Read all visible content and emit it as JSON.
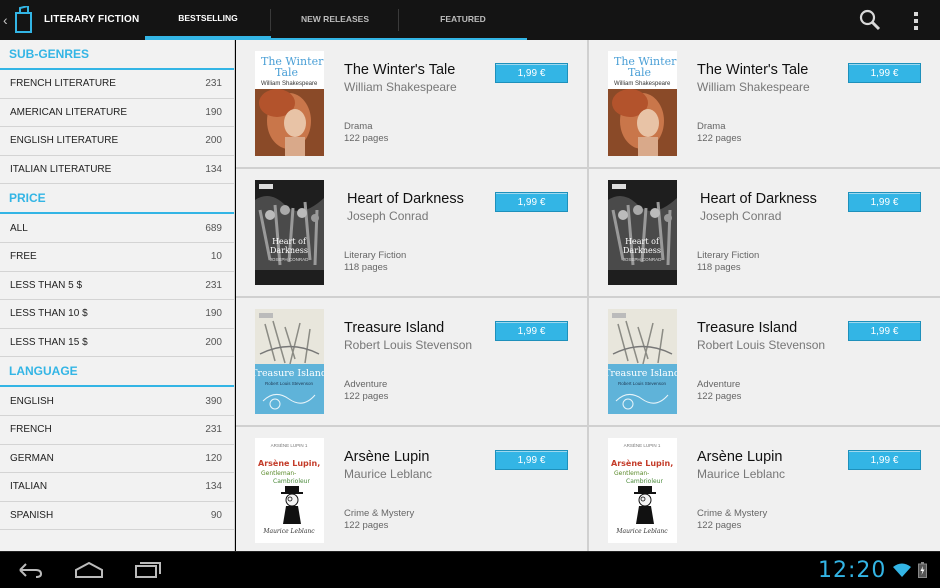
{
  "header": {
    "title": "LITERARY FICTION",
    "tabs": [
      {
        "label": "BESTSELLING",
        "active": true
      },
      {
        "label": "NEW RELEASES",
        "active": false
      },
      {
        "label": "FEATURED",
        "active": false
      }
    ],
    "accent": "#33b5e5"
  },
  "sidebar": {
    "sections": [
      {
        "title": "SUB-GENRES",
        "items": [
          {
            "label": "FRENCH LITERATURE",
            "count": "231"
          },
          {
            "label": "AMERICAN LITERATURE",
            "count": "190"
          },
          {
            "label": "ENGLISH LITERATURE",
            "count": "200"
          },
          {
            "label": "ITALIAN LITERATURE",
            "count": "134"
          }
        ]
      },
      {
        "title": "PRICE",
        "items": [
          {
            "label": "ALL",
            "count": "689"
          },
          {
            "label": "FREE",
            "count": "10"
          },
          {
            "label": "LESS THAN 5 $",
            "count": "231"
          },
          {
            "label": "LESS THAN 10 $",
            "count": "190"
          },
          {
            "label": "LESS THAN 15 $",
            "count": "200"
          }
        ]
      },
      {
        "title": "LANGUAGE",
        "items": [
          {
            "label": "ENGLISH",
            "count": "390"
          },
          {
            "label": "FRENCH",
            "count": "231"
          },
          {
            "label": "GERMAN",
            "count": "120"
          },
          {
            "label": "ITALIAN",
            "count": "134"
          },
          {
            "label": "SPANISH",
            "count": "90"
          }
        ]
      }
    ]
  },
  "books": [
    {
      "title": "The Winter's Tale",
      "author": "William Shakespeare",
      "genre": "Drama",
      "pages": "122 pages",
      "price": "1,99 €",
      "cover": "winter"
    },
    {
      "title": "The Winter's Tale",
      "author": "William Shakespeare",
      "genre": "Drama",
      "pages": "122 pages",
      "price": "1,99 €",
      "cover": "winter"
    },
    {
      "title": "Heart of Darkness",
      "author": "Joseph Conrad",
      "genre": "Literary Fiction",
      "pages": "118 pages",
      "price": "1,99 €",
      "cover": "heart"
    },
    {
      "title": "Heart of Darkness",
      "author": "Joseph Conrad",
      "genre": "Literary Fiction",
      "pages": "118 pages",
      "price": "1,99 €",
      "cover": "heart"
    },
    {
      "title": "Treasure Island",
      "author": "Robert Louis Stevenson",
      "genre": "Adventure",
      "pages": "122 pages",
      "price": "1,99 €",
      "cover": "treasure"
    },
    {
      "title": "Treasure Island",
      "author": "Robert Louis Stevenson",
      "genre": "Adventure",
      "pages": "122 pages",
      "price": "1,99 €",
      "cover": "treasure"
    },
    {
      "title": "Arsène Lupin",
      "author": "Maurice Leblanc",
      "genre": "Crime & Mystery",
      "pages": "122 pages",
      "price": "1,99 €",
      "cover": "lupin"
    },
    {
      "title": "Arsène Lupin",
      "author": "Maurice Leblanc",
      "genre": "Crime & Mystery",
      "pages": "122 pages",
      "price": "1,99 €",
      "cover": "lupin"
    }
  ],
  "covers": {
    "winter": {
      "line1": "The Winter's",
      "line2": "Tale",
      "author": "William Shakespeare"
    },
    "heart": {
      "line1": "Heart of",
      "line2": "Darkness",
      "author": "JOSEPH CONRAD"
    },
    "treasure": {
      "line1": "Treasure Island",
      "author": "Robert Louis Stevenson"
    },
    "lupin": {
      "series": "ARSÈNE LUPIN 1",
      "line1": "Arsène Lupin,",
      "line2": "Gentleman-",
      "line3": "Cambrioleur",
      "author": "Maurice Leblanc"
    }
  },
  "statusbar": {
    "time": "12:20"
  }
}
